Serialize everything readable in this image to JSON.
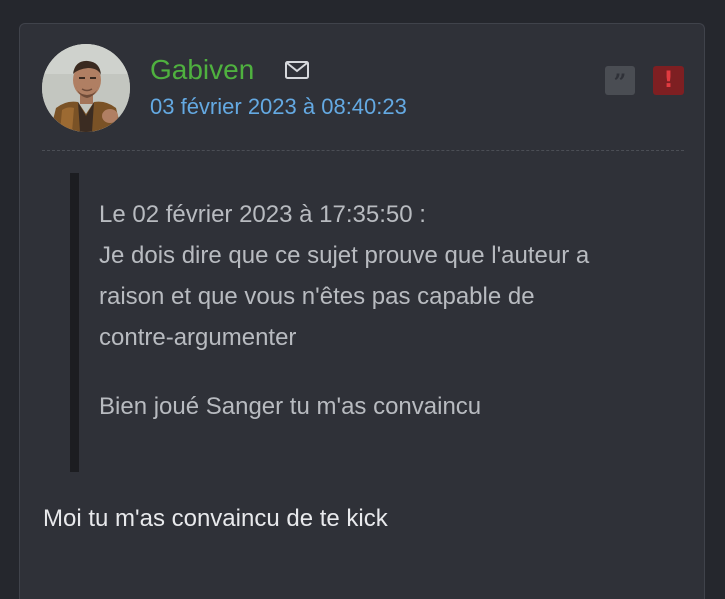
{
  "post": {
    "author": "Gabiven",
    "date": "03 février 2023 à 08:40:23",
    "icons": {
      "avatar": "avatar",
      "message": "mail-icon",
      "quote": "quote-icon",
      "report": "alert-icon"
    },
    "quote_glyph": "”",
    "report_glyph": "!",
    "quote": {
      "header": "Le 02 février 2023 à 17:35:50 :",
      "lines": [
        "Je dois dire que ce sujet prouve que l'auteur a",
        "raison et que vous n'êtes pas capable de",
        "contre-argumenter"
      ],
      "second_paragraph": "Bien joué Sanger tu m'as convaincu"
    },
    "reply": "Moi tu m'as convaincu de te kick"
  },
  "colors": {
    "page_background": "#25272d",
    "card_background": "#2f3138",
    "author": "#4fb13f",
    "date": "#64a9e2",
    "quote_text": "#b8bbc0",
    "reply_text": "#e8e9ec",
    "report_button": "#7e1f22"
  }
}
